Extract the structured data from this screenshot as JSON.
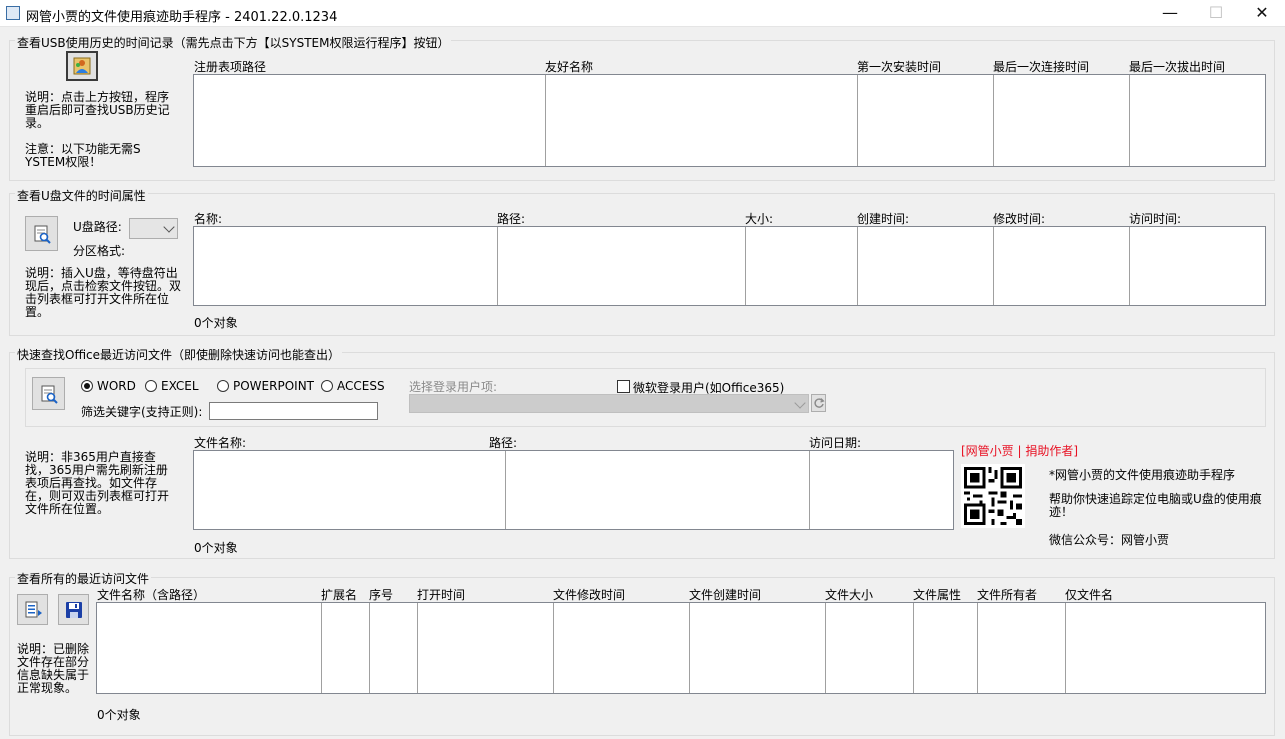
{
  "window": {
    "title": "网管小贾的文件使用痕迹助手程序 - 2401.22.0.1234",
    "minimize": "—",
    "maximize": "☐",
    "close": "✕"
  },
  "usb": {
    "group_title": "查看USB使用历史的时间记录（需先点击下方【以SYSTEM权限运行程序】按钮）",
    "note1": "说明：点击上方按钮，程序重启后即可查找USB历史记录。",
    "note2": "注意：以下功能无需SYSTEM权限！",
    "columns": [
      "注册表项路径",
      "友好名称",
      "第一次安装时间",
      "最后一次连接时间",
      "最后一次拔出时间"
    ]
  },
  "udisk": {
    "group_title": "查看U盘文件的时间属性",
    "path_label": "U盘路径:",
    "partition_label": "分区格式:",
    "note": "说明：插入U盘，等待盘符出现后，点击检索文件按钮。双击列表框可打开文件所在位置。",
    "columns": [
      "名称:",
      "路径:",
      "大小:",
      "创建时间:",
      "修改时间:",
      "访问时间:"
    ],
    "count": "0个对象"
  },
  "office": {
    "group_title": "快速查找Office最近访问文件（即使删除快速访问也能查出）",
    "radios": [
      "WORD",
      "EXCEL",
      "POWERPOINT",
      "ACCESS"
    ],
    "selected_radio": "WORD",
    "user_label": "选择登录用户项:",
    "ms_account_label": "微软登录用户(如Office365)",
    "filter_label": "筛选关键字(支持正则):",
    "filter_value": "",
    "note": "说明：非365用户直接查找，365用户需先刷新注册表项后再查找。如文件存在，则可双击列表框可打开文件所在位置。",
    "columns": [
      "文件名称:",
      "路径:",
      "访问日期:"
    ],
    "count": "0个对象"
  },
  "promo": {
    "donate_link": "[网管小贾 | 捐助作者]",
    "line1": "*网管小贾的文件使用痕迹助手程序",
    "line2": "帮助你快速追踪定位电脑或U盘的使用痕迹！",
    "line3": "微信公众号：网管小贾"
  },
  "recent": {
    "group_title": "查看所有的最近访问文件",
    "note": "说明：已删除文件存在部分信息缺失属于正常现象。",
    "columns": [
      "文件名称（含路径）",
      "扩展名",
      "序号",
      "打开时间",
      "文件修改时间",
      "文件创建时间",
      "文件大小",
      "文件属性",
      "文件所有者",
      "仅文件名"
    ],
    "count": "0个对象"
  },
  "colors": {
    "window_bg": "#f0f0f0",
    "list_bg": "#ffffff",
    "link_red": "#e81123"
  }
}
